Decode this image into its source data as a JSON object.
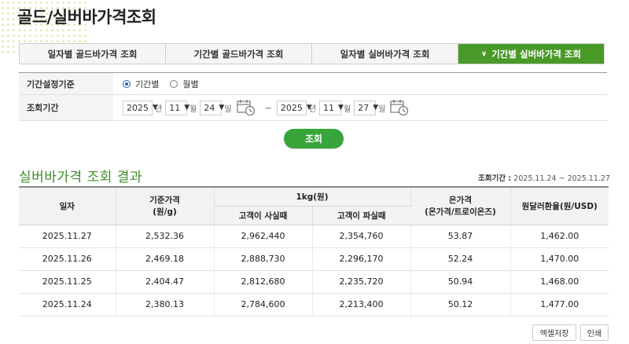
{
  "page": {
    "title": "골드/실버바가격조회"
  },
  "tabs": [
    {
      "label": "일자별 골드바가격 조회",
      "active": false
    },
    {
      "label": "기간별 골드바가격 조회",
      "active": false
    },
    {
      "label": "일자별 실버바가격 조회",
      "active": false
    },
    {
      "label": "기간별 실버바가격 조회",
      "active": true
    }
  ],
  "conditions": {
    "period_type_label": "기간설정기준",
    "radio_period": "기간별",
    "radio_month": "월별",
    "selected": "기간별",
    "range_label": "조회기간",
    "start": {
      "year": "2025",
      "month": "11",
      "day": "24"
    },
    "end": {
      "year": "2025",
      "month": "11",
      "day": "27"
    },
    "unit_year": "년",
    "unit_month": "월",
    "unit_day": "일",
    "tilde": "~"
  },
  "search_button": "조회",
  "result": {
    "title": "실버바가격 조회 결과",
    "period_label": "조회기간 :",
    "period_value": "2025.11.24 ~ 2025.11.27"
  },
  "table": {
    "headers": {
      "date": "일자",
      "base_price": "기준가격",
      "base_price_unit": "(원/g)",
      "kg_group": "1kg(원)",
      "buy": "고객이 사실때",
      "sell": "고객이 파실때",
      "silver_price": "은가격",
      "silver_price_unit": "(온가격/트로이온즈)",
      "fx": "원달러환율(원/USD)"
    },
    "rows": [
      [
        "2025.11.27",
        "2,532.36",
        "2,962,440",
        "2,354,760",
        "53.87",
        "1,462.00"
      ],
      [
        "2025.11.26",
        "2,469.18",
        "2,888,730",
        "2,296,170",
        "52.24",
        "1,470.00"
      ],
      [
        "2025.11.25",
        "2,404.47",
        "2,812,680",
        "2,235,720",
        "50.94",
        "1,468.00"
      ],
      [
        "2025.11.24",
        "2,380.13",
        "2,784,600",
        "2,213,400",
        "50.12",
        "1,477.00"
      ]
    ]
  },
  "footer": {
    "excel": "엑셀저장",
    "print": "인쇄"
  },
  "colors": {
    "accent": "#4a9a2a",
    "button": "#37a53a",
    "title_green": "#3d8c27"
  }
}
